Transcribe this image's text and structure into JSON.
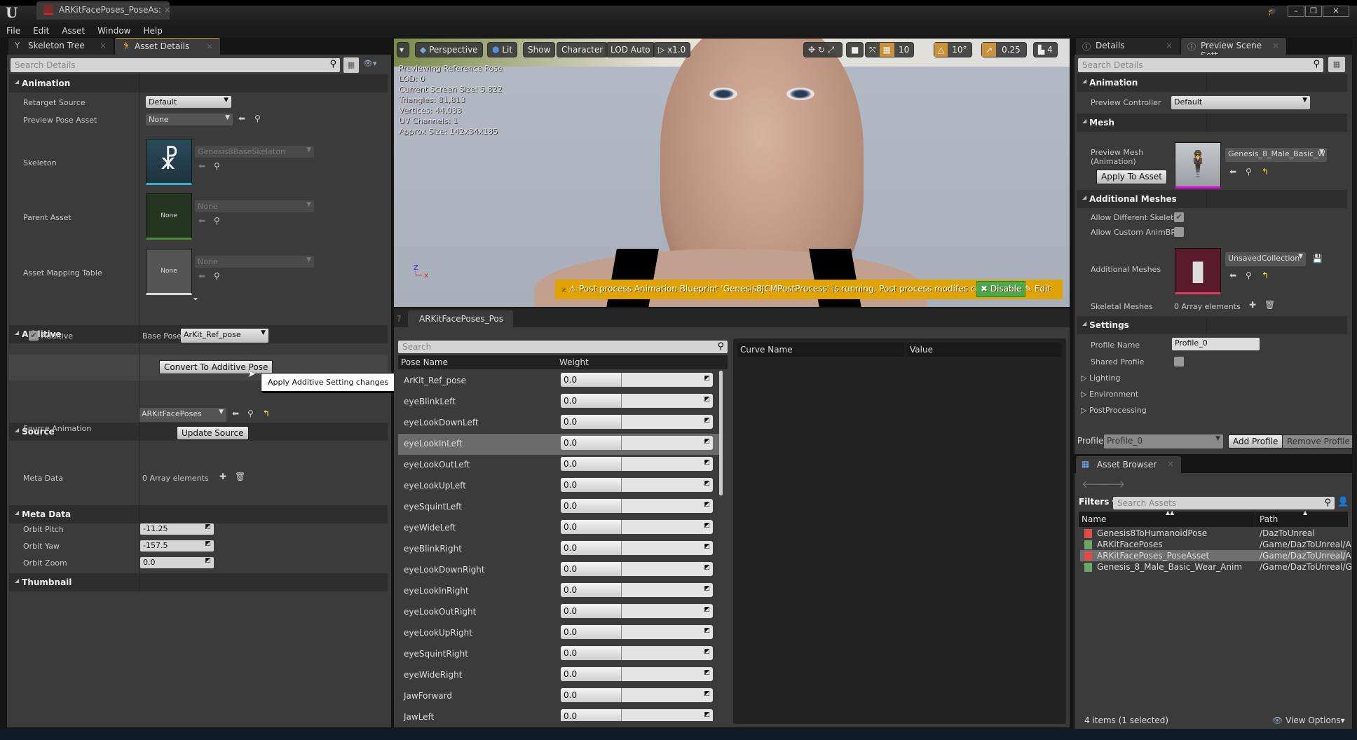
{
  "window": {
    "doc_tab": "ARKitFacePoses_PoseAs:",
    "logo": "U"
  },
  "menu": [
    "File",
    "Edit",
    "Asset",
    "Window",
    "Help"
  ],
  "left_tabs": [
    {
      "label": "Skeleton Tree"
    },
    {
      "label": "Asset Details"
    }
  ],
  "left": {
    "search_placeholder": "Search Details",
    "animation": {
      "header": "Animation",
      "retarget_label": "Retarget Source",
      "retarget_value": "Default",
      "preview_pose_label": "Preview Pose Asset",
      "preview_pose_value": "None",
      "skeleton_label": "Skeleton",
      "skeleton_value": "Genesis8BaseSkeleton",
      "parent_label": "Parent Asset",
      "parent_value": "None",
      "parent_thumb": "None",
      "mapping_label": "Asset Mapping Table",
      "mapping_value": "None",
      "mapping_thumb": "None"
    },
    "additive": {
      "header": "Additive",
      "checkbox_label": "Additive",
      "checked": true,
      "base_pose_label": "Base Pose",
      "base_pose_value": "ArKit_Ref_pose",
      "convert_button": "Convert To Additive Pose",
      "tooltip": "Apply Additive Setting changes"
    },
    "source": {
      "header": "Source",
      "label": "Source Animation",
      "value": "ARKitFacePoses",
      "update_button": "Update Source"
    },
    "meta": {
      "header": "Meta Data",
      "label": "Meta Data",
      "value": "0 Array elements"
    },
    "thumbnail": {
      "header": "Thumbnail",
      "orbit_pitch_label": "Orbit Pitch",
      "orbit_pitch": "-11.25",
      "orbit_yaw_label": "Orbit Yaw",
      "orbit_yaw": "-157.5",
      "orbit_zoom_label": "Orbit Zoom",
      "orbit_zoom": "0.0"
    }
  },
  "viewport": {
    "toolbar": {
      "perspective": "Perspective",
      "lit": "Lit",
      "show": "Show",
      "character": "Character",
      "lod": "LOD Auto",
      "speed": "x1.0",
      "grid_snap": "10",
      "rot_snap": "10°",
      "scale_snap": "0.25",
      "camera_speed": "4"
    },
    "stats": [
      "Previewing Reference Pose",
      "LOD: 0",
      "Current Screen Size: 5.822",
      "Triangles: 81,813",
      "Vertices: 44,033",
      "UV Channels: 1",
      "Approx Size: 142x34x185"
    ],
    "warning": "Post process Animation Blueprint 'Genesis8JCMPostProcess' is running. Post process modifes curves.",
    "disable": "Disable",
    "edit": "Edit",
    "warning_color": "#e0a300"
  },
  "pose_panel": {
    "tab": "ARKitFacePoses_Pos",
    "search_placeholder": "Search",
    "col_pose": "Pose Name",
    "col_weight": "Weight",
    "col_curve": "Curve Name",
    "col_value": "Value",
    "selected": "eyeLookInLeft",
    "poses": [
      {
        "name": "ArKit_Ref_pose",
        "weight": "0.0"
      },
      {
        "name": "eyeBlinkLeft",
        "weight": "0.0"
      },
      {
        "name": "eyeLookDownLeft",
        "weight": "0.0"
      },
      {
        "name": "eyeLookInLeft",
        "weight": "0.0"
      },
      {
        "name": "eyeLookOutLeft",
        "weight": "0.0"
      },
      {
        "name": "eyeLookUpLeft",
        "weight": "0.0"
      },
      {
        "name": "eyeSquintLeft",
        "weight": "0.0"
      },
      {
        "name": "eyeWideLeft",
        "weight": "0.0"
      },
      {
        "name": "eyeBlinkRight",
        "weight": "0.0"
      },
      {
        "name": "eyeLookDownRight",
        "weight": "0.0"
      },
      {
        "name": "eyeLookInRight",
        "weight": "0.0"
      },
      {
        "name": "eyeLookOutRight",
        "weight": "0.0"
      },
      {
        "name": "eyeLookUpRight",
        "weight": "0.0"
      },
      {
        "name": "eyeSquintRight",
        "weight": "0.0"
      },
      {
        "name": "eyeWideRight",
        "weight": "0.0"
      },
      {
        "name": "JawForward",
        "weight": "0.0"
      },
      {
        "name": "JawLeft",
        "weight": "0.0"
      }
    ]
  },
  "right_tabs": [
    {
      "label": "Details"
    },
    {
      "label": "Preview Scene Sett"
    }
  ],
  "right": {
    "search_placeholder": "Search Details",
    "animation": {
      "header": "Animation",
      "controller_label": "Preview Controller",
      "controller_value": "Default"
    },
    "mesh": {
      "header": "Mesh",
      "label": "Preview Mesh (Animation)",
      "apply_button": "Apply To Asset",
      "value": "Genesis_8_Male_Basic_W"
    },
    "additional": {
      "header": "Additional Meshes",
      "allow_diff_label": "Allow Different Skeleto",
      "allow_diff": true,
      "allow_custom_label": "Allow Custom AnimBP",
      "allow_custom": false,
      "meshes_label": "Additional Meshes",
      "meshes_value": "UnsavedCollection",
      "skeletal_label": "Skeletal Meshes",
      "skeletal_value": "0 Array elements"
    },
    "settings": {
      "header": "Settings",
      "profile_name_label": "Profile Name",
      "profile_name": "Profile_0",
      "shared_label": "Shared Profile",
      "shared": false,
      "lighting": "Lighting",
      "environment": "Environment",
      "postprocessing": "PostProcessing"
    },
    "profile_label": "Profile",
    "profile_value": "Profile_0",
    "add_profile": "Add Profile",
    "remove_profile": "Remove Profile"
  },
  "asset_browser": {
    "tab": "Asset Browser",
    "filters": "Filters",
    "search_placeholder": "Search Assets",
    "col_name": "Name",
    "col_path": "Path",
    "items": [
      {
        "name": "Genesis8ToHumanoidPose",
        "path": "/DazToUnreal",
        "color": "#e04a4a"
      },
      {
        "name": "ARKitFacePoses",
        "path": "/Game/DazToUnreal/A",
        "color": "#6aa86a"
      },
      {
        "name": "ARKitFacePoses_PoseAsset",
        "path": "/Game/DazToUnreal/A",
        "color": "#e04a4a",
        "selected": true
      },
      {
        "name": "Genesis_8_Male_Basic_Wear_Anim",
        "path": "/Game/DazToUnreal/G",
        "color": "#6aa86a"
      }
    ],
    "status": "4 items (1 selected)",
    "view_options": "View Options"
  }
}
